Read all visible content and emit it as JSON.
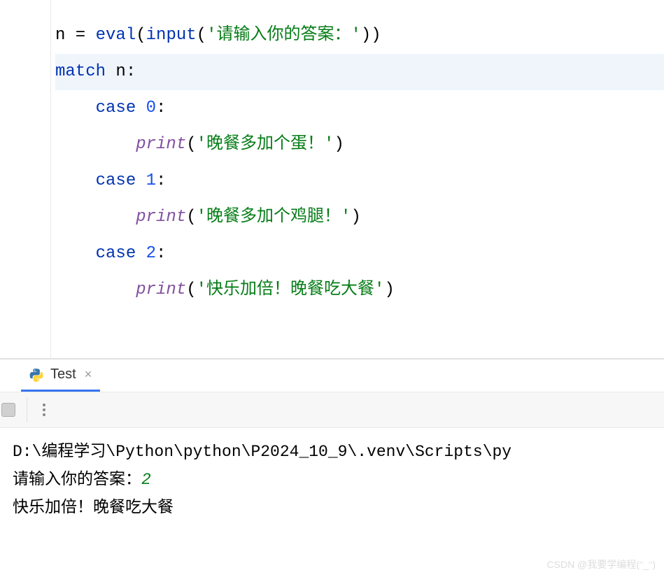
{
  "code": {
    "line1": {
      "var": "n",
      "op": " = ",
      "fn1": "eval",
      "paren1": "(",
      "fn2": "input",
      "paren2": "(",
      "str": "'请输入你的答案：'",
      "paren3": "))"
    },
    "line2": {
      "kw": "match",
      "var": " n",
      "colon": ":"
    },
    "line3": {
      "kw": "case",
      "num": " 0",
      "colon": ":"
    },
    "line4": {
      "fn": "print",
      "paren1": "(",
      "str": "'晚餐多加个蛋！'",
      "paren2": ")"
    },
    "line5": {
      "kw": "case",
      "num": " 1",
      "colon": ":"
    },
    "line6": {
      "fn": "print",
      "paren1": "(",
      "str": "'晚餐多加个鸡腿！'",
      "paren2": ")"
    },
    "line7": {
      "kw": "case",
      "num": " 2",
      "colon": ":"
    },
    "line8": {
      "fn": "print",
      "paren1": "(",
      "str": "'快乐加倍！晚餐吃大餐'",
      "paren2": ")"
    }
  },
  "console": {
    "tab_name": "Test",
    "path": "D:\\编程学习\\Python\\python\\P2024_10_9\\.venv\\Scripts\\py",
    "prompt": "请输入你的答案：",
    "input_value": "2",
    "output": "快乐加倍！晚餐吃大餐"
  },
  "watermark": "CSDN @我要学编程(ᵔ_ᵔ)"
}
